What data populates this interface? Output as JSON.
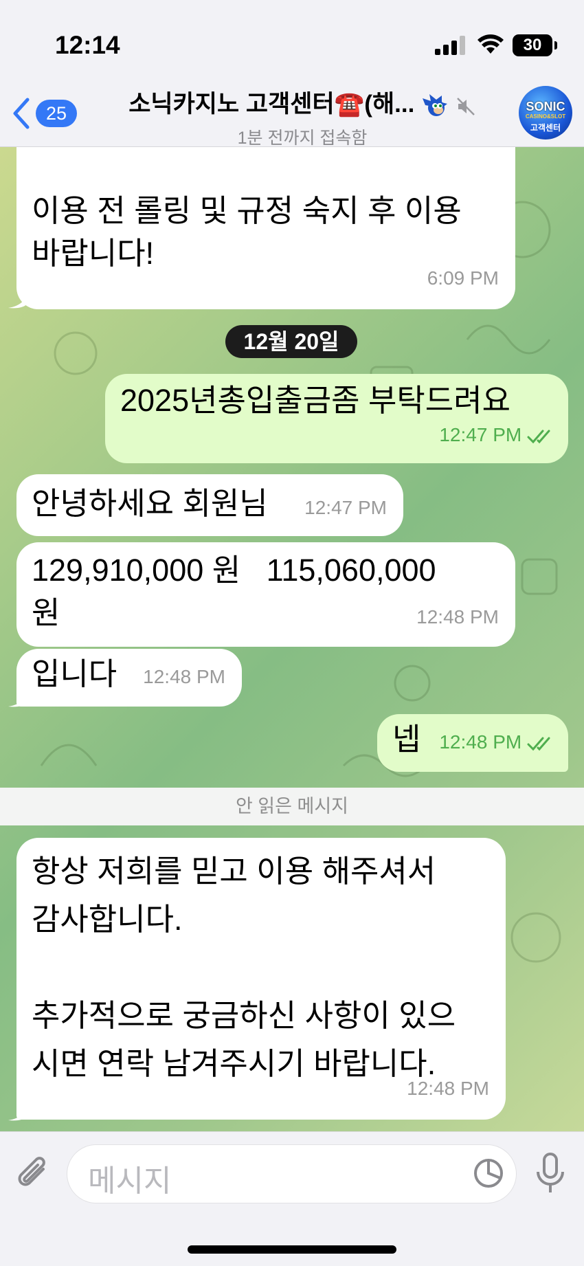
{
  "status_bar": {
    "time": "12:14",
    "battery": "30"
  },
  "header": {
    "back_count": "25",
    "title": "소닉카지노 고객센터☎️(해...",
    "subtitle": "1분 전까지 접속함",
    "avatar_text": [
      "SONIC",
      "CASINO&SLOT",
      "고객센터"
    ]
  },
  "chat": {
    "partial_top_message": {
      "text": "이용 전 롤링 및 규정 숙지 후 이용\n바랍니다!",
      "time": "6:09 PM"
    },
    "date_separator": "12월 20일",
    "messages": [
      {
        "direction": "out",
        "text": "2025년총입출금좀 부탁드려요",
        "time": "12:47 PM",
        "read": true
      },
      {
        "direction": "in",
        "text": "안녕하세요 회원님",
        "time": "12:47 PM"
      },
      {
        "direction": "in",
        "text": "129,910,000 원   115,060,000\n원",
        "time": "12:48 PM"
      },
      {
        "direction": "in",
        "text": "입니다",
        "time": "12:48 PM"
      },
      {
        "direction": "out",
        "text": "넵",
        "time": "12:48 PM",
        "read": true
      }
    ],
    "unread_divider": "안 읽은 메시지",
    "last_message": {
      "text": "항상 저희를 믿고 이용 해주셔서\n감사합니다.\n\n추가적으로 궁금하신 사항이 있으\n시면 연락 남겨주시기 바랍니다.",
      "time": "12:48 PM"
    }
  },
  "input": {
    "placeholder": "메시지"
  },
  "colors": {
    "accent": "#3478f6",
    "outgoing_bubble": "#e2fcc9",
    "read_check": "#4fae4e"
  }
}
